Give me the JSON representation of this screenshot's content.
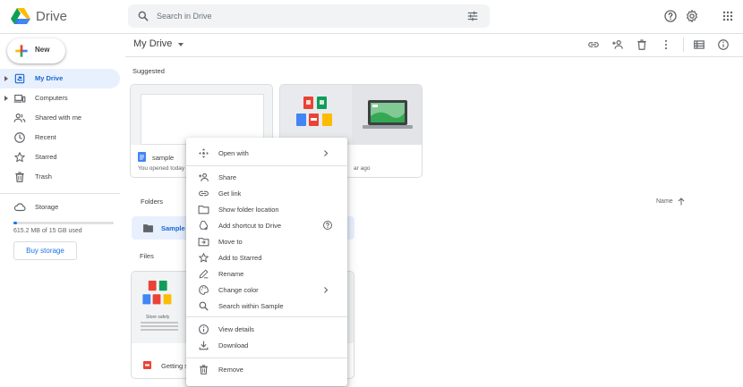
{
  "app": {
    "name": "Drive"
  },
  "search": {
    "placeholder": "Search in Drive"
  },
  "sidebar": {
    "new_label": "New",
    "items": [
      {
        "label": "My Drive"
      },
      {
        "label": "Computers"
      },
      {
        "label": "Shared with me"
      },
      {
        "label": "Recent"
      },
      {
        "label": "Starred"
      },
      {
        "label": "Trash"
      },
      {
        "label": "Storage"
      }
    ],
    "storage_used": 0.04,
    "storage_text": "615.2 MB of 15 GB used",
    "buy_label": "Buy storage"
  },
  "main": {
    "title": "My Drive",
    "suggested_label": "Suggested",
    "suggested": [
      {
        "name": "sample",
        "subtitle": "You opened today"
      },
      {
        "name": "",
        "subtitle": "ar ago"
      }
    ],
    "folders_label": "Folders",
    "sort_label": "Name",
    "folder": {
      "name": "Sample"
    },
    "files_label": "Files",
    "file": {
      "name": "Getting s",
      "thumb_title": "Store safely"
    }
  },
  "context_menu": {
    "items": [
      {
        "label": "Open with",
        "submenu": true
      },
      {
        "label": "Share"
      },
      {
        "label": "Get link"
      },
      {
        "label": "Show folder location"
      },
      {
        "label": "Add shortcut to Drive"
      },
      {
        "label": "Move to"
      },
      {
        "label": "Add to Starred"
      },
      {
        "label": "Rename"
      },
      {
        "label": "Change color",
        "submenu": true
      },
      {
        "label": "Search within Sample"
      },
      {
        "label": "View details"
      },
      {
        "label": "Download"
      },
      {
        "label": "Remove"
      }
    ]
  },
  "colors": {
    "accent": "#1a73e8",
    "active_bg": "#e8f0fe",
    "text": "#3c4043",
    "icon": "#5f6368"
  }
}
